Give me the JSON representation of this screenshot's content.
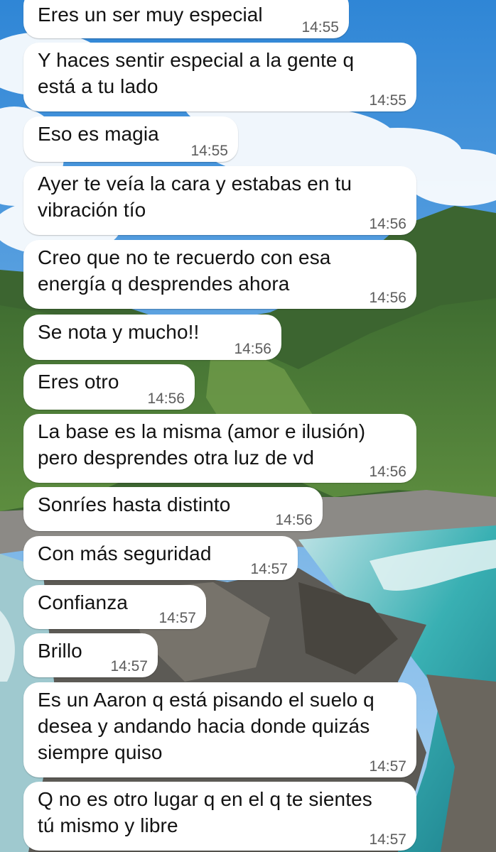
{
  "background": {
    "description_icon": "wallpaper-photo-coast-icon",
    "sky_color": "#8fc0ea",
    "sea_color": "#2ea5a8",
    "hill_color": "#4d7a3a"
  },
  "messages": [
    {
      "text": "Eres un ser muy especial",
      "time": "14:55"
    },
    {
      "text": "Y haces sentir especial a la gente q\nestá a tu lado",
      "time": "14:55"
    },
    {
      "text": "Eso es magia",
      "time": "14:55"
    },
    {
      "text": "Ayer te veía la cara y estabas en tu\nvibración tío",
      "time": "14:56"
    },
    {
      "text": "Creo que no te recuerdo con esa\nenergía q desprendes ahora",
      "time": "14:56"
    },
    {
      "text": "Se nota y mucho!!",
      "time": "14:56"
    },
    {
      "text": "Eres otro",
      "time": "14:56"
    },
    {
      "text": "La base es la misma (amor e ilusión)\npero desprendes otra luz de vd",
      "time": "14:56"
    },
    {
      "text": "Sonríes hasta distinto",
      "time": "14:56"
    },
    {
      "text": "Con más seguridad",
      "time": "14:57"
    },
    {
      "text": "Confianza",
      "time": "14:57"
    },
    {
      "text": "Brillo",
      "time": "14:57"
    },
    {
      "text": "Es un Aaron q está pisando el suelo q\ndesea y andando hacia donde quizás\nsiempre quiso",
      "time": "14:57"
    },
    {
      "text": "Q no es otro lugar q en el q te sientes\ntú mismo y libre",
      "time": "14:57"
    }
  ]
}
